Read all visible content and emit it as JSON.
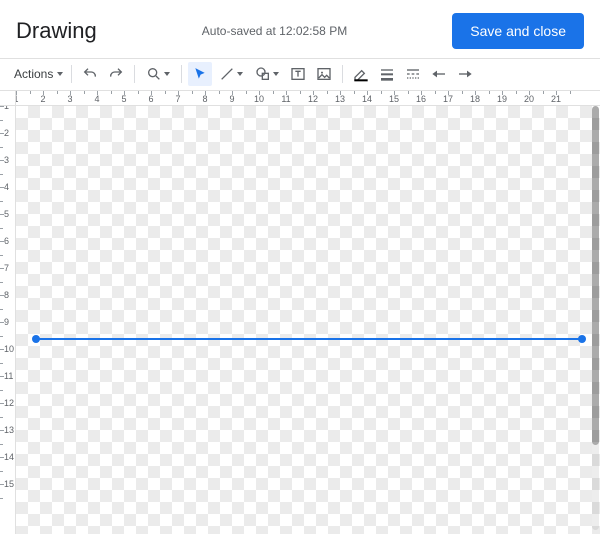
{
  "header": {
    "title": "Drawing",
    "status": "Auto-saved at 12:02:58 PM",
    "save_label": "Save and close"
  },
  "toolbar": {
    "actions_label": "Actions"
  },
  "ruler": {
    "h": [
      "1",
      "2",
      "3",
      "4",
      "5",
      "6",
      "7",
      "8",
      "9",
      "10",
      "11",
      "12",
      "13",
      "14",
      "15",
      "16",
      "17",
      "18",
      "19",
      "20",
      "21"
    ],
    "v": [
      "1",
      "2",
      "3",
      "4",
      "5",
      "6",
      "7",
      "8",
      "9",
      "10",
      "11",
      "12",
      "13",
      "14",
      "15"
    ]
  },
  "colors": {
    "accent": "#1a73e8"
  },
  "shape": {
    "type": "line",
    "color": "#1a73e8",
    "selected": true
  }
}
